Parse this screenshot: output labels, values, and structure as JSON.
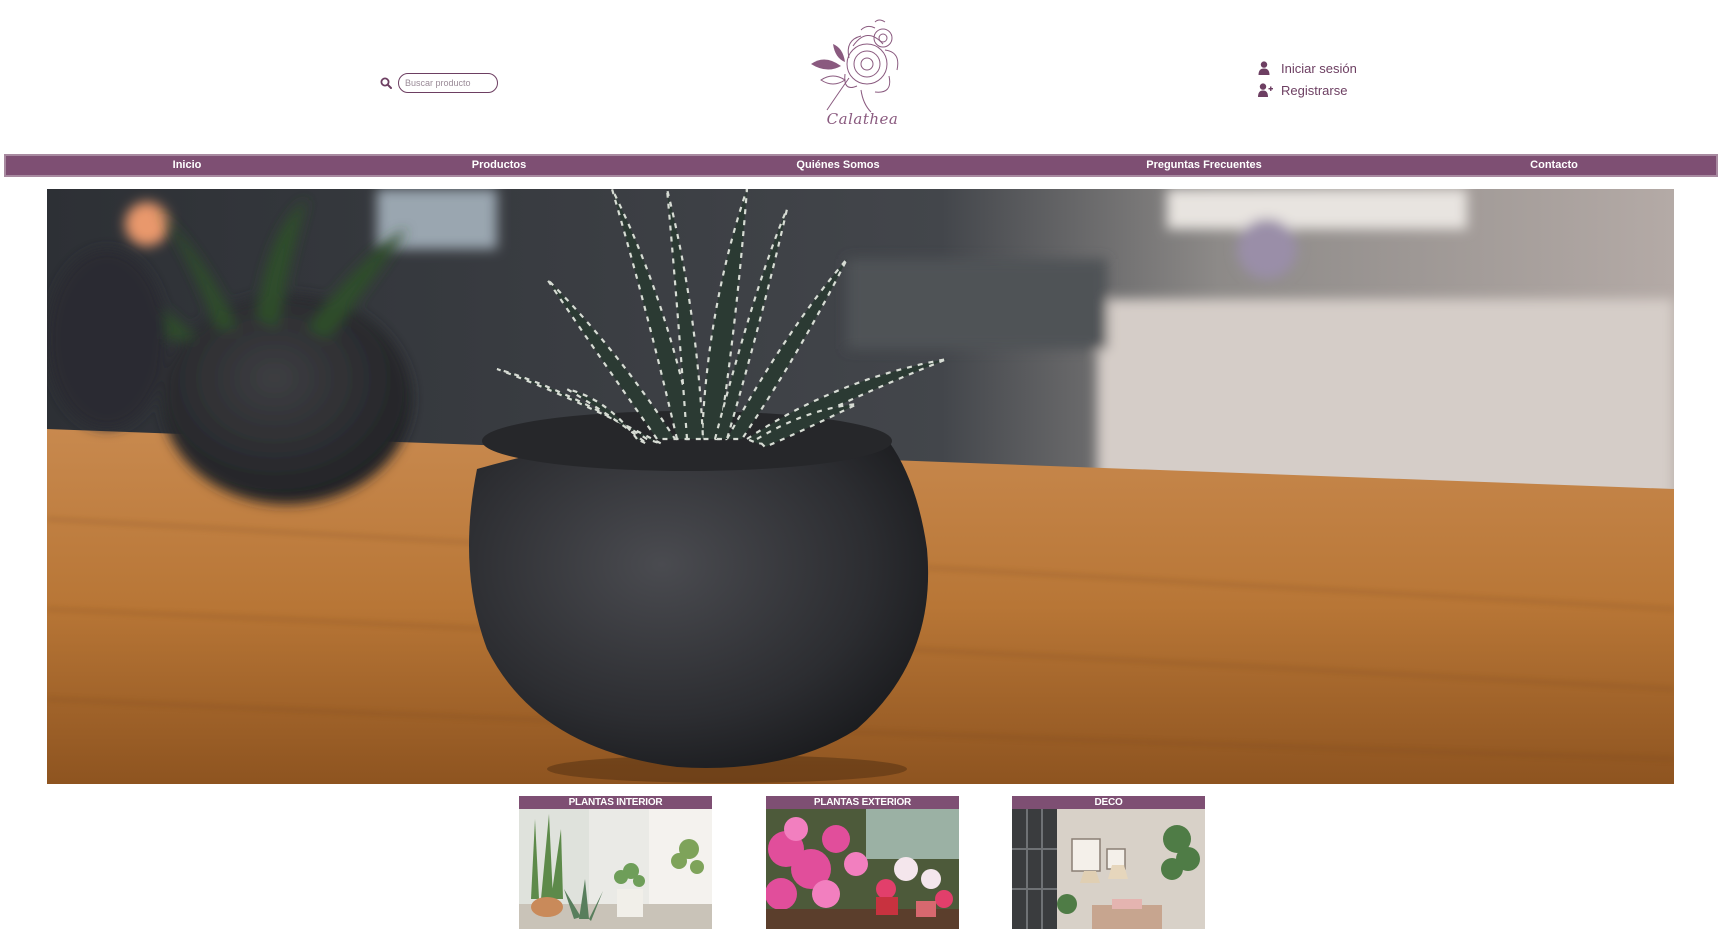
{
  "header": {
    "search": {
      "placeholder": "Buscar producto",
      "value": ""
    },
    "logo": {
      "text": "Calathea"
    },
    "account": {
      "login_label": "Iniciar sesión",
      "register_label": "Registrarse"
    }
  },
  "nav": {
    "items": [
      {
        "label": "Inicio"
      },
      {
        "label": "Productos"
      },
      {
        "label": "Quiénes Somos"
      },
      {
        "label": "Preguntas Frecuentes"
      },
      {
        "label": "Contacto"
      }
    ]
  },
  "categories": [
    {
      "label": "PLANTAS INTERIOR"
    },
    {
      "label": "PLANTAS EXTERIOR"
    },
    {
      "label": "DECO"
    }
  ],
  "icons": {
    "search": "search-icon",
    "login": "user-icon",
    "register": "user-plus-icon"
  },
  "colors": {
    "brand": "#7e4f73",
    "text": "#6d3f62"
  }
}
